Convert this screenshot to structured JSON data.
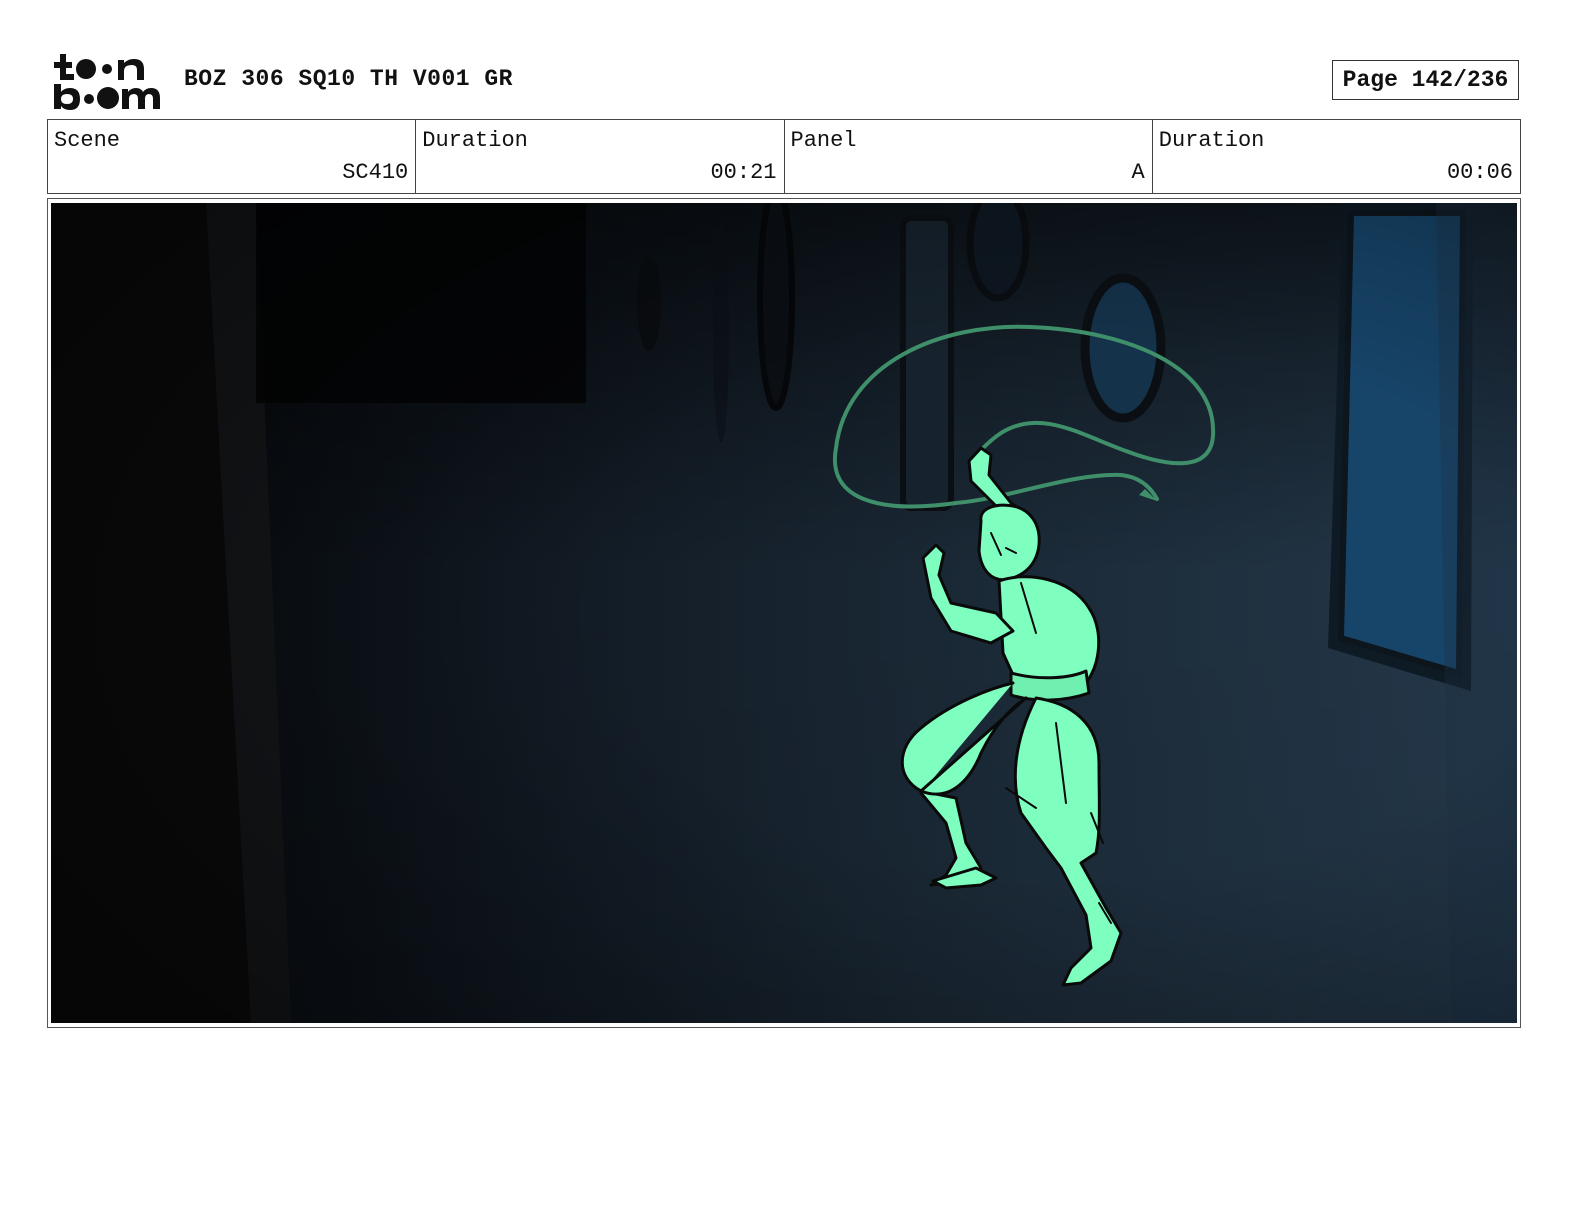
{
  "header": {
    "logo": "toon boom",
    "project_title": "BOZ 306 SQ10 TH V001 GR",
    "page_label": "Page 142/236"
  },
  "info": {
    "scene_label": "Scene",
    "scene_value": "SC410",
    "scene_duration_label": "Duration",
    "scene_duration_value": "00:21",
    "panel_label": "Panel",
    "panel_value": "A",
    "panel_duration_label": "Duration",
    "panel_duration_value": "00:06"
  },
  "panel_image": {
    "icon": "storyboard-drawing",
    "colors": {
      "background_wall": "#1c2a37",
      "shadow_wall": "#0d0f12",
      "character_fill": "#7effc0",
      "whip_stroke": "#3f8f6a",
      "line_art": "#0a0a0a"
    }
  }
}
